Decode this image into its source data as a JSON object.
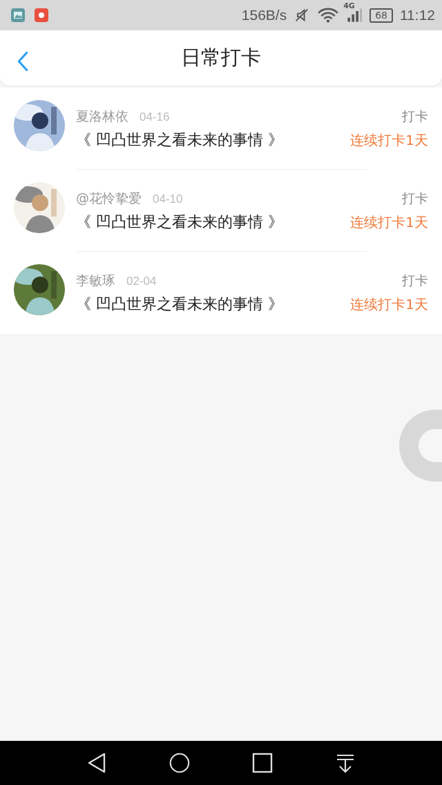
{
  "status_bar": {
    "speed": "156B/s",
    "network": "4G",
    "battery": "68",
    "time": "11:12"
  },
  "header": {
    "title": "日常打卡"
  },
  "items": [
    {
      "name": "夏洛林依",
      "date": "04-16",
      "book": "《 凹凸世界之看未来的事情 》",
      "action": "打卡",
      "streak": "连续打卡1天"
    },
    {
      "name": "@花怜挚爱",
      "date": "04-10",
      "book": "《 凹凸世界之看未来的事情 》",
      "action": "打卡",
      "streak": "连续打卡1天"
    },
    {
      "name": "李敏琢",
      "date": "02-04",
      "book": "《 凹凸世界之看未来的事情 》",
      "action": "打卡",
      "streak": "连续打卡1天"
    }
  ]
}
